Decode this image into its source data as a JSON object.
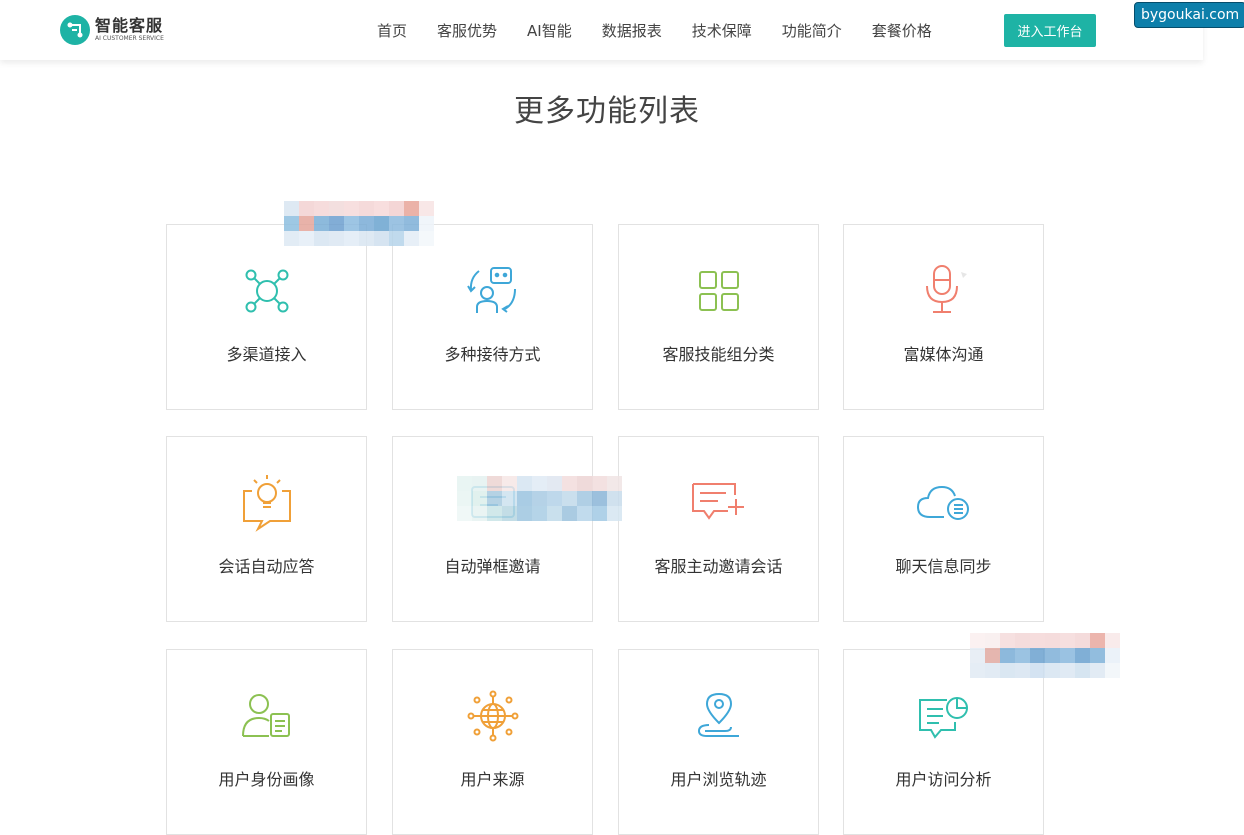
{
  "header": {
    "logo": {
      "title": "智能客服",
      "subtitle": "AI CUSTOMER SERVICE"
    },
    "nav": [
      "首页",
      "客服优势",
      "AI智能",
      "数据报表",
      "技术保障",
      "功能简介",
      "套餐价格"
    ],
    "cta": "进入工作台"
  },
  "watermark": "bygoukai.com",
  "section": {
    "title": "更多功能列表"
  },
  "features": [
    {
      "label": "多渠道接入",
      "icon": "network-nodes-icon",
      "color": "#2fbfae"
    },
    {
      "label": "多种接待方式",
      "icon": "reception-cycle-icon",
      "color": "#3ea7d8"
    },
    {
      "label": "客服技能组分类",
      "icon": "grid-apps-icon",
      "color": "#8cc152"
    },
    {
      "label": "富媒体沟通",
      "icon": "microphone-icon",
      "color": "#f07f6e"
    },
    {
      "label": "会话自动应答",
      "icon": "lightbulb-chat-icon",
      "color": "#f0a038"
    },
    {
      "label": "自动弹框邀请",
      "icon": "popup-invite-icon",
      "color": "#3ea7d8"
    },
    {
      "label": "客服主动邀请会话",
      "icon": "chat-add-icon",
      "color": "#f07f6e"
    },
    {
      "label": "聊天信息同步",
      "icon": "cloud-sync-icon",
      "color": "#3ea7d8"
    },
    {
      "label": "用户身份画像",
      "icon": "user-profile-icon",
      "color": "#8cc152"
    },
    {
      "label": "用户来源",
      "icon": "globe-source-icon",
      "color": "#f0a038"
    },
    {
      "label": "用户浏览轨迹",
      "icon": "location-path-icon",
      "color": "#3ea7d8"
    },
    {
      "label": "用户访问分析",
      "icon": "chat-analytics-icon",
      "color": "#2fbfae"
    }
  ],
  "colors": {
    "brand": "#1eb3a5"
  }
}
